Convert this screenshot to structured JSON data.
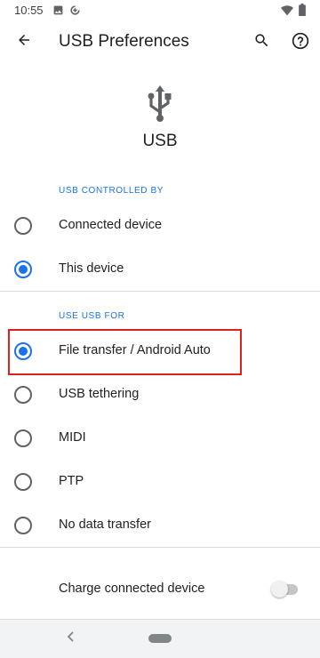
{
  "status_bar": {
    "time": "10:55",
    "left_icons": [
      "image-icon",
      "data-saver-icon"
    ],
    "right_icons": [
      "wifi-icon",
      "battery-icon"
    ]
  },
  "app_bar": {
    "title": "USB Preferences",
    "back_icon": "arrow-back-icon",
    "search_icon": "search-icon",
    "help_icon": "help-icon"
  },
  "header": {
    "icon": "usb-icon",
    "label": "USB"
  },
  "usb_controlled_by": {
    "title": "USB CONTROLLED BY",
    "options": [
      {
        "label": "Connected device",
        "checked": false
      },
      {
        "label": "This device",
        "checked": true
      }
    ]
  },
  "use_usb_for": {
    "title": "USE USB FOR",
    "options": [
      {
        "label": "File transfer / Android Auto",
        "checked": true
      },
      {
        "label": "USB tethering",
        "checked": false
      },
      {
        "label": "MIDI",
        "checked": false
      },
      {
        "label": "PTP",
        "checked": false
      },
      {
        "label": "No data transfer",
        "checked": false
      }
    ]
  },
  "charge": {
    "label": "Charge connected device",
    "enabled": false
  },
  "colors": {
    "accent": "#1a73e8",
    "highlight": "#e02020",
    "text": "#202124",
    "icon": "#5f6368"
  },
  "nav_bar": {
    "back_icon": "nav-back-icon",
    "home_icon": "nav-home-pill"
  }
}
